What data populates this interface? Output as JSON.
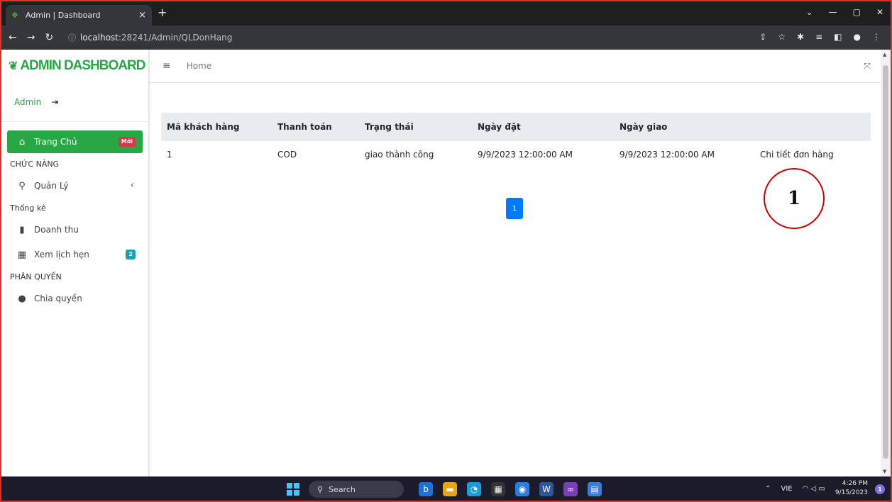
{
  "browser": {
    "tab_title": "Admin | Dashboard",
    "tab_close": "×",
    "new_tab": "+",
    "url_host": "localhost",
    "url_rest": ":28241/Admin/QLDonHang"
  },
  "sidebar": {
    "brand": "ADMIN DASHBOARD",
    "user": "Admin",
    "items": [
      {
        "label": "Trang Chủ",
        "badge": "Mới",
        "icon": "home-icon"
      },
      {
        "header": "CHỨC NĂNG"
      },
      {
        "label": "Quản Lý",
        "icon": "search-icon"
      },
      {
        "header": "Thống kê"
      },
      {
        "label": "Doanh thu",
        "icon": "file-icon"
      },
      {
        "label": "Xem lịch hẹn",
        "badge": "2",
        "icon": "calendar-icon"
      },
      {
        "header": "PHÂN QUYỀN"
      },
      {
        "label": "Chia quyền",
        "icon": "circle-icon"
      }
    ]
  },
  "header": {
    "home": "Home"
  },
  "table": {
    "columns": [
      "Mã khách hàng",
      "Thanh toán",
      "Trạng thái",
      "Ngày đặt",
      "Ngày giao",
      ""
    ],
    "rows": [
      [
        "1",
        "COD",
        "giao thành công",
        "9/9/2023 12:00:00 AM",
        "9/9/2023 12:00:00 AM",
        "Chi tiết đơn hàng"
      ]
    ]
  },
  "pagination": {
    "current": "1"
  },
  "annotation": {
    "label": "1"
  },
  "taskbar": {
    "search": "Search",
    "lang": "VIE",
    "time": "4:26 PM",
    "date": "9/15/2023",
    "notifications": "1"
  },
  "colors": {
    "accent": "#28a745",
    "link": "#3c8dbc",
    "page_button": "#007bff",
    "annotation_circle": "#cc0000"
  }
}
